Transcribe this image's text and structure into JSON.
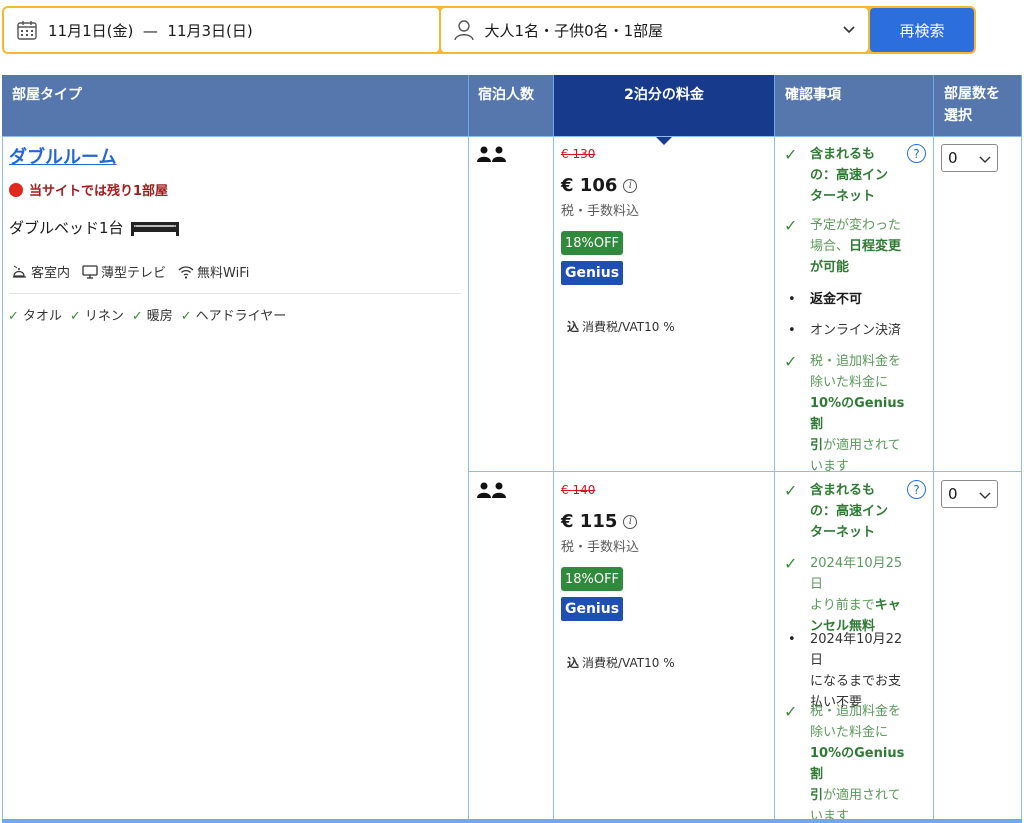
{
  "search": {
    "dates": "11月1日(金)  —  11月3日(日)",
    "guests": "大人1名・子供0名・1部屋",
    "search_button": "再検索",
    "calendar_icon": "calendar-icon",
    "person_icon": "person-icon"
  },
  "table": {
    "headers": {
      "room_type": "部屋タイプ",
      "occupancy": "宿泊人数",
      "price": "2泊分の料金",
      "conditions": "確認事項",
      "select_rooms": "部屋数を選択"
    }
  },
  "room": {
    "name": "ダブルルーム",
    "scarcity": "当サイトでは残り1部屋",
    "bed": "ダブルベッド1台",
    "amenities": [
      {
        "icon": "room-service-icon",
        "label": "客室内"
      },
      {
        "icon": "tv-icon",
        "label": "薄型テレビ"
      },
      {
        "icon": "wifi-icon",
        "label": "無料WiFi"
      }
    ],
    "facilities": [
      "タオル",
      "リネン",
      "暖房",
      "ヘアドライヤー"
    ]
  },
  "offers": [
    {
      "occupancy_icon": "two-persons-icon",
      "old_price": "€ 130",
      "price": "€ 106",
      "tax_note": "税・手数料込",
      "discount_badge": "18%OFF",
      "genius_badge": "Genius",
      "vat_prefix": "込",
      "vat": "消費税/VAT10 %",
      "conditions": {
        "included_l1": "含まれるも",
        "included_l2": "の：高速イン",
        "included_l3": "ターネット",
        "change_l1": "予定が変わった",
        "change_l2a": "場合、",
        "change_l2b": "日程変更",
        "change_l3": "が可能",
        "nonrefundable": "返金不可",
        "payment": "オンライン決済",
        "genius_l1": "税・追加料金を",
        "genius_l2": "除いた料金に",
        "genius_l3": "10%のGenius割",
        "genius_l4a": "引",
        "genius_l4b": "が適用されて",
        "genius_l5": "います"
      },
      "quantity": "0"
    },
    {
      "occupancy_icon": "two-persons-icon",
      "old_price": "€ 140",
      "price": "€ 115",
      "tax_note": "税・手数料込",
      "discount_badge": "18%OFF",
      "genius_badge": "Genius",
      "vat_prefix": "込",
      "vat": "消費税/VAT10 %",
      "conditions": {
        "included_l1": "含まれるも",
        "included_l2": "の：高速イン",
        "included_l3": "ターネット",
        "cancel_l1": "2024年10月25日",
        "cancel_l2a": "より前まで",
        "cancel_l2b": "キャ",
        "cancel_l3": "ンセル無料",
        "pay_l1": "2024年10月22日",
        "pay_l2": "になるまでお支",
        "pay_l3": "払い不要",
        "genius_l1": "税・追加料金を",
        "genius_l2": "除いた料金に",
        "genius_l3": "10%のGenius割",
        "genius_l4a": "引",
        "genius_l4b": "が適用されて",
        "genius_l5": "います"
      },
      "quantity": "0"
    }
  ],
  "colors": {
    "header_bg": "#5677ad",
    "header_active": "#173a8c",
    "search_border": "#f5b82e",
    "button_blue": "#2c6fdc",
    "discount_green": "#2f8a3c",
    "genius_blue": "#1f4fb5",
    "scarcity_red": "#e0281d"
  }
}
